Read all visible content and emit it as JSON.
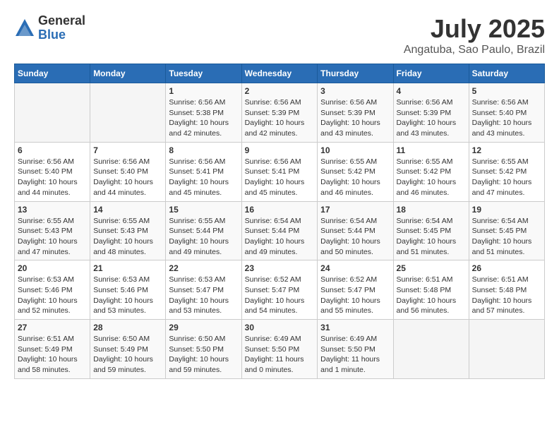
{
  "header": {
    "logo_general": "General",
    "logo_blue": "Blue",
    "title": "July 2025",
    "subtitle": "Angatuba, Sao Paulo, Brazil"
  },
  "weekdays": [
    "Sunday",
    "Monday",
    "Tuesday",
    "Wednesday",
    "Thursday",
    "Friday",
    "Saturday"
  ],
  "weeks": [
    [
      {
        "day": "",
        "info": ""
      },
      {
        "day": "",
        "info": ""
      },
      {
        "day": "1",
        "info": "Sunrise: 6:56 AM\nSunset: 5:38 PM\nDaylight: 10 hours and 42 minutes."
      },
      {
        "day": "2",
        "info": "Sunrise: 6:56 AM\nSunset: 5:39 PM\nDaylight: 10 hours and 42 minutes."
      },
      {
        "day": "3",
        "info": "Sunrise: 6:56 AM\nSunset: 5:39 PM\nDaylight: 10 hours and 43 minutes."
      },
      {
        "day": "4",
        "info": "Sunrise: 6:56 AM\nSunset: 5:39 PM\nDaylight: 10 hours and 43 minutes."
      },
      {
        "day": "5",
        "info": "Sunrise: 6:56 AM\nSunset: 5:40 PM\nDaylight: 10 hours and 43 minutes."
      }
    ],
    [
      {
        "day": "6",
        "info": "Sunrise: 6:56 AM\nSunset: 5:40 PM\nDaylight: 10 hours and 44 minutes."
      },
      {
        "day": "7",
        "info": "Sunrise: 6:56 AM\nSunset: 5:40 PM\nDaylight: 10 hours and 44 minutes."
      },
      {
        "day": "8",
        "info": "Sunrise: 6:56 AM\nSunset: 5:41 PM\nDaylight: 10 hours and 45 minutes."
      },
      {
        "day": "9",
        "info": "Sunrise: 6:56 AM\nSunset: 5:41 PM\nDaylight: 10 hours and 45 minutes."
      },
      {
        "day": "10",
        "info": "Sunrise: 6:55 AM\nSunset: 5:42 PM\nDaylight: 10 hours and 46 minutes."
      },
      {
        "day": "11",
        "info": "Sunrise: 6:55 AM\nSunset: 5:42 PM\nDaylight: 10 hours and 46 minutes."
      },
      {
        "day": "12",
        "info": "Sunrise: 6:55 AM\nSunset: 5:42 PM\nDaylight: 10 hours and 47 minutes."
      }
    ],
    [
      {
        "day": "13",
        "info": "Sunrise: 6:55 AM\nSunset: 5:43 PM\nDaylight: 10 hours and 47 minutes."
      },
      {
        "day": "14",
        "info": "Sunrise: 6:55 AM\nSunset: 5:43 PM\nDaylight: 10 hours and 48 minutes."
      },
      {
        "day": "15",
        "info": "Sunrise: 6:55 AM\nSunset: 5:44 PM\nDaylight: 10 hours and 49 minutes."
      },
      {
        "day": "16",
        "info": "Sunrise: 6:54 AM\nSunset: 5:44 PM\nDaylight: 10 hours and 49 minutes."
      },
      {
        "day": "17",
        "info": "Sunrise: 6:54 AM\nSunset: 5:44 PM\nDaylight: 10 hours and 50 minutes."
      },
      {
        "day": "18",
        "info": "Sunrise: 6:54 AM\nSunset: 5:45 PM\nDaylight: 10 hours and 51 minutes."
      },
      {
        "day": "19",
        "info": "Sunrise: 6:54 AM\nSunset: 5:45 PM\nDaylight: 10 hours and 51 minutes."
      }
    ],
    [
      {
        "day": "20",
        "info": "Sunrise: 6:53 AM\nSunset: 5:46 PM\nDaylight: 10 hours and 52 minutes."
      },
      {
        "day": "21",
        "info": "Sunrise: 6:53 AM\nSunset: 5:46 PM\nDaylight: 10 hours and 53 minutes."
      },
      {
        "day": "22",
        "info": "Sunrise: 6:53 AM\nSunset: 5:47 PM\nDaylight: 10 hours and 53 minutes."
      },
      {
        "day": "23",
        "info": "Sunrise: 6:52 AM\nSunset: 5:47 PM\nDaylight: 10 hours and 54 minutes."
      },
      {
        "day": "24",
        "info": "Sunrise: 6:52 AM\nSunset: 5:47 PM\nDaylight: 10 hours and 55 minutes."
      },
      {
        "day": "25",
        "info": "Sunrise: 6:51 AM\nSunset: 5:48 PM\nDaylight: 10 hours and 56 minutes."
      },
      {
        "day": "26",
        "info": "Sunrise: 6:51 AM\nSunset: 5:48 PM\nDaylight: 10 hours and 57 minutes."
      }
    ],
    [
      {
        "day": "27",
        "info": "Sunrise: 6:51 AM\nSunset: 5:49 PM\nDaylight: 10 hours and 58 minutes."
      },
      {
        "day": "28",
        "info": "Sunrise: 6:50 AM\nSunset: 5:49 PM\nDaylight: 10 hours and 59 minutes."
      },
      {
        "day": "29",
        "info": "Sunrise: 6:50 AM\nSunset: 5:50 PM\nDaylight: 10 hours and 59 minutes."
      },
      {
        "day": "30",
        "info": "Sunrise: 6:49 AM\nSunset: 5:50 PM\nDaylight: 11 hours and 0 minutes."
      },
      {
        "day": "31",
        "info": "Sunrise: 6:49 AM\nSunset: 5:50 PM\nDaylight: 11 hours and 1 minute."
      },
      {
        "day": "",
        "info": ""
      },
      {
        "day": "",
        "info": ""
      }
    ]
  ]
}
